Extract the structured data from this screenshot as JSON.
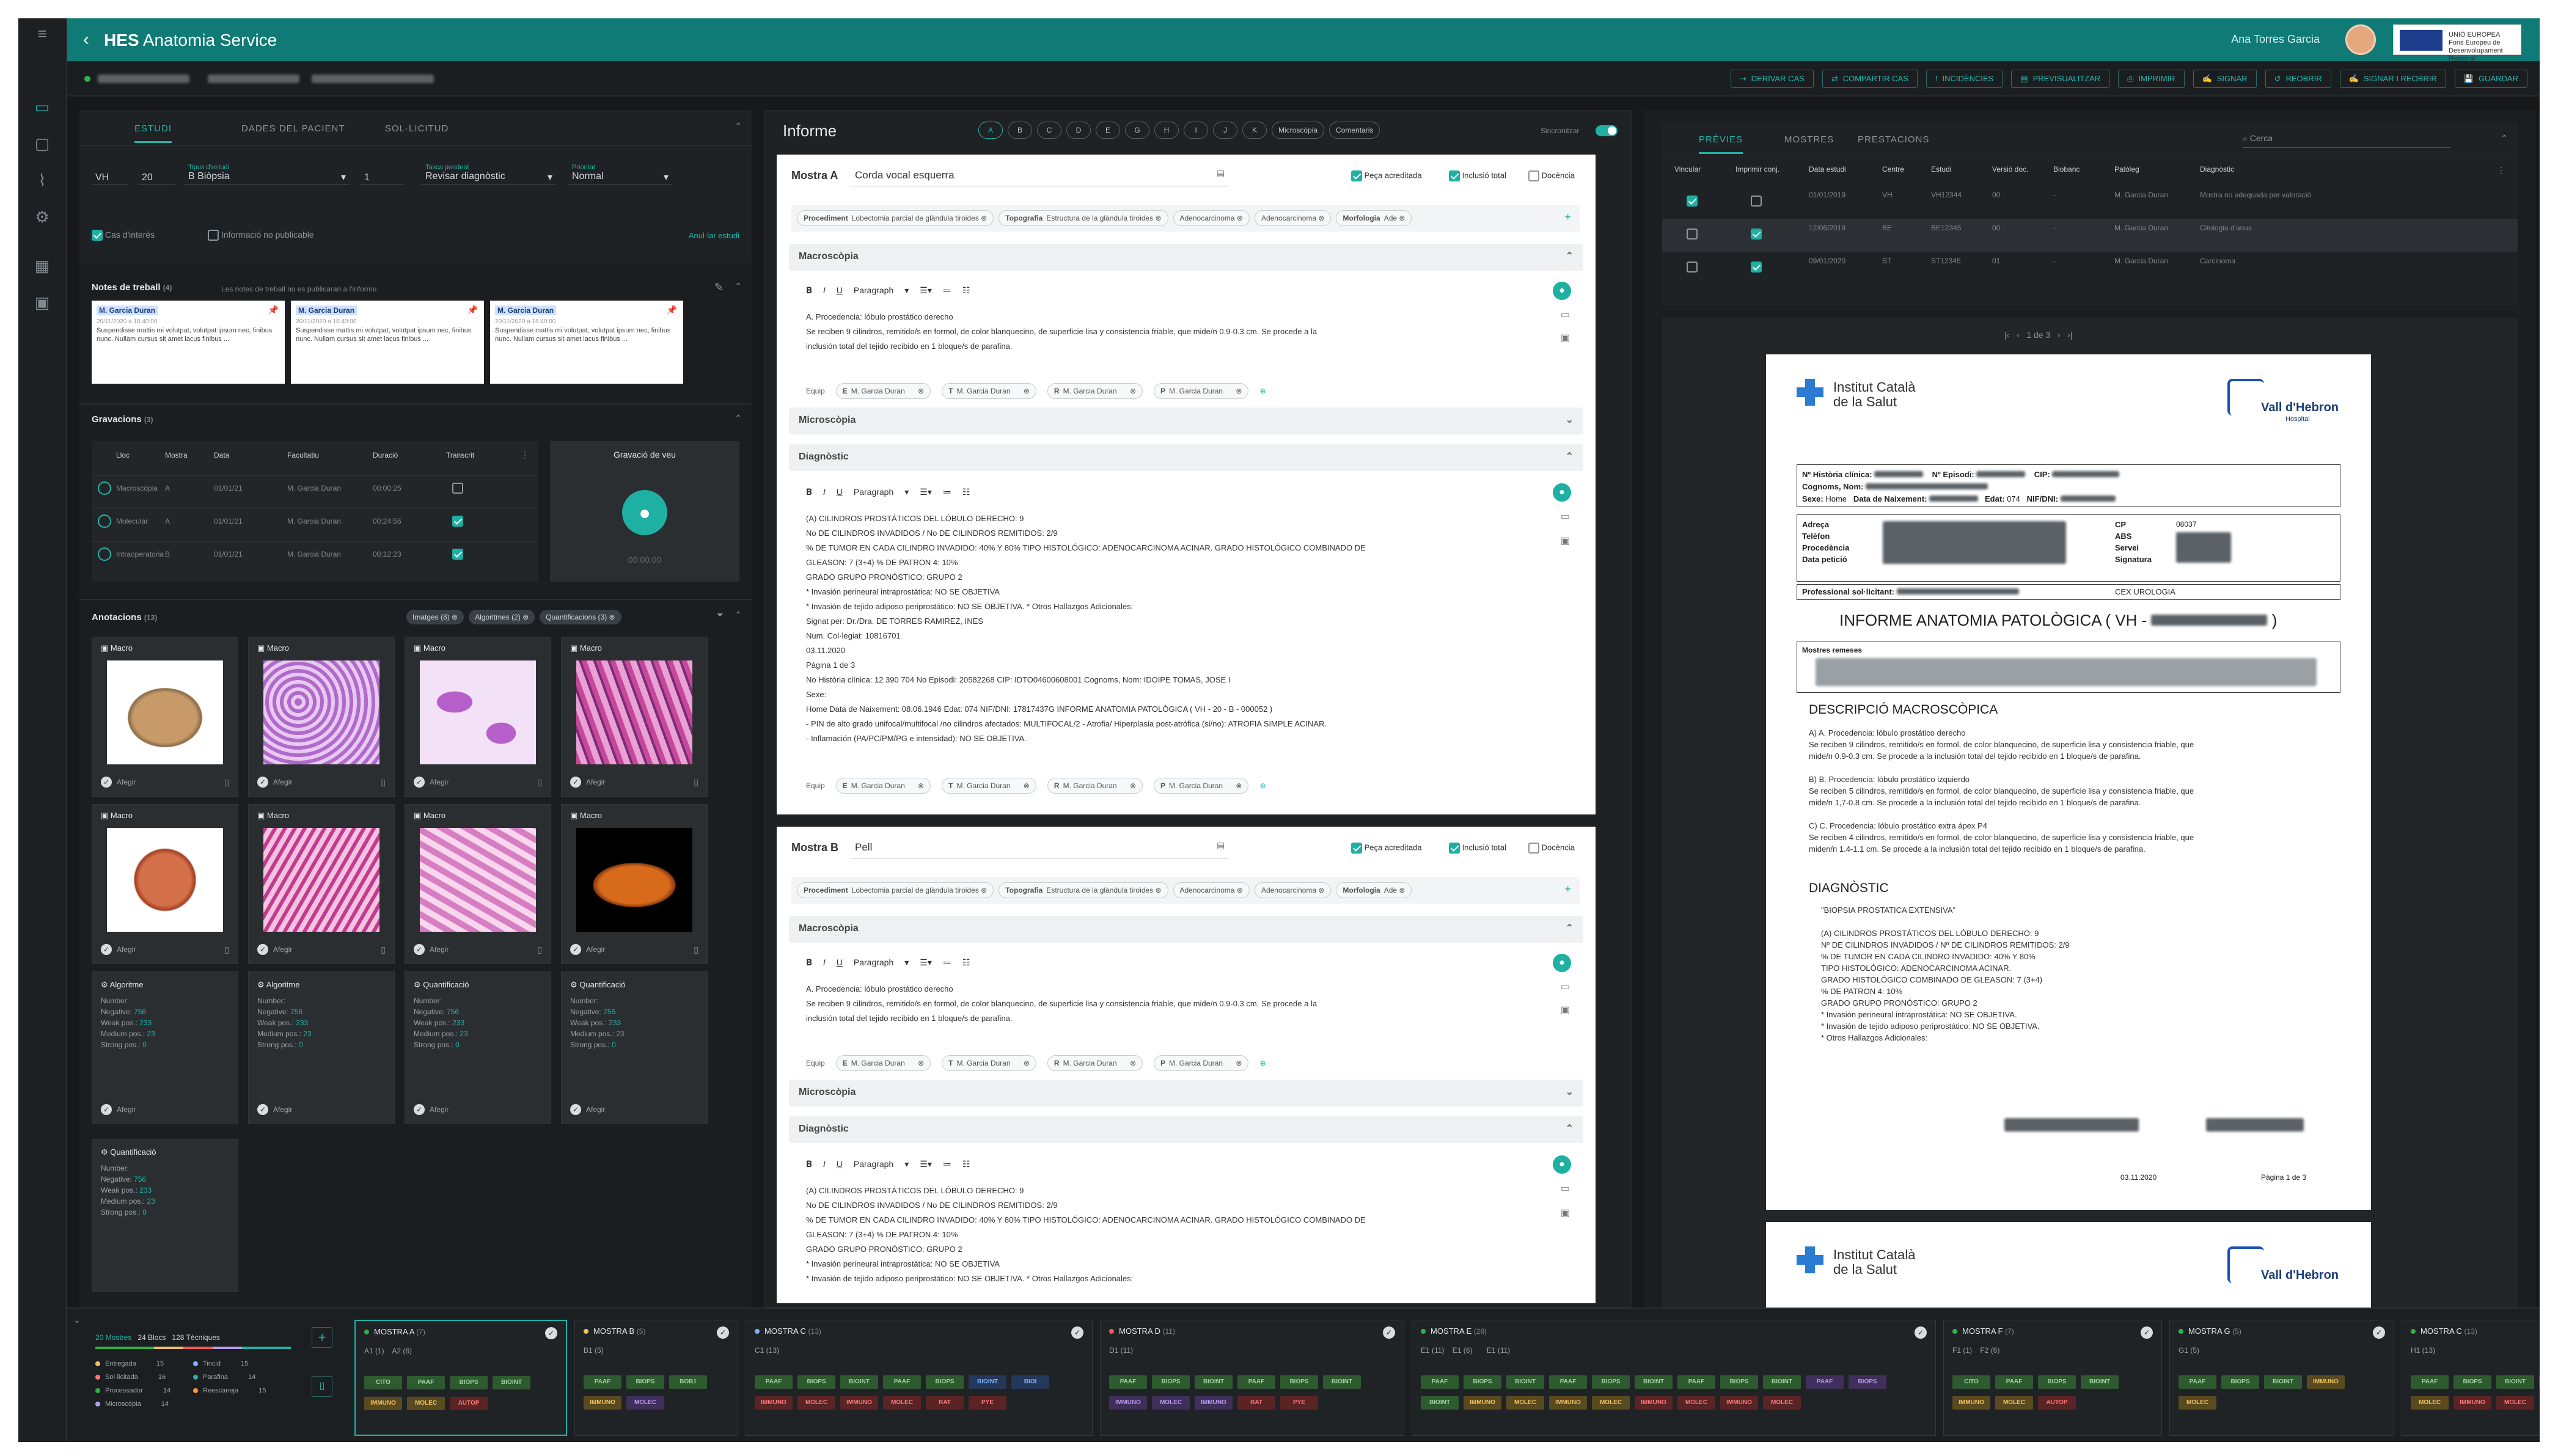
{
  "app": {
    "title_bold": "HES",
    "title_rest": "Anatomia Service",
    "user": "Ana Torres Garcia",
    "eu_text": "UNIÓ EUROPEA\nFons Europeu de\nDesenvolupament Regional"
  },
  "actions": [
    "DERIVAR CAS",
    "COMPARTIR CAS",
    "INCIDÈNCIES",
    "PREVISUALITZAR",
    "IMPRIMIR",
    "SIGNAR",
    "REOBRIR",
    "SIGNAR I REOBRIR",
    "GUARDAR"
  ],
  "left": {
    "tabs": [
      "ESTUDI",
      "DADES DEL PACIENT",
      "SOL·LICITUD"
    ],
    "study": {
      "prefix": "VH",
      "year": "20",
      "type_label": "Tipus d'estudi",
      "type_value": "B Biòpsia",
      "num": "1",
      "task_label": "Tasca pendent",
      "task_value": "Revisar diagnòstic",
      "prio_label": "Prioritat",
      "prio_value": "Normal",
      "interest": "Cas d'interès",
      "nopub": "Informació no publicable",
      "cancel": "Anul·lar estudi"
    },
    "notes": {
      "title": "Notes de treball",
      "count": "(4)",
      "hint": "Les notes de treball no es publicaran a l'informe",
      "items": [
        {
          "author": "M. Garcia Duran",
          "date": "20/11/2020 a 18:40:00",
          "text": "Suspendisse mattis mi volutpat, volutpat ipsum nec, finibus nunc. Nullam cursus sit amet lacus finibus ..."
        },
        {
          "author": "M. Garcia Duran",
          "date": "20/11/2020 a 18:40:00",
          "text": "Suspendisse mattis mi volutpat, volutpat ipsum nec, finibus nunc. Nullam cursus sit amet lacus finibus ..."
        },
        {
          "author": "M. Garcia Duran",
          "date": "20/11/2020 a 18:40:00",
          "text": "Suspendisse mattis mi volutpat, volutpat ipsum nec, finibus nunc. Nullam cursus sit amet lacus finibus ..."
        }
      ]
    },
    "recordings": {
      "title": "Gravacions",
      "count": "(3)",
      "cols": [
        "Lloc",
        "Mostra",
        "Data",
        "Facultatiu",
        "Duració",
        "Transcrit"
      ],
      "rows": [
        {
          "place": "Macroscòpia",
          "sample": "A",
          "date": "01/01/21",
          "doctor": "M. Garcia Duran",
          "dur": "00:00:25",
          "done": false
        },
        {
          "place": "Molecular",
          "sample": "A",
          "date": "01/01/21",
          "doctor": "M. Garcia Duran",
          "dur": "00:24:56",
          "done": true
        },
        {
          "place": "Intraoperatoria",
          "sample": "B",
          "date": "01/01/21",
          "doctor": "M. Garcia Duran",
          "dur": "00:12:23",
          "done": true
        }
      ],
      "voice_title": "Gravació de veu",
      "voice_time": "00:00:00"
    },
    "annotations": {
      "title": "Anotacions",
      "count": "(13)",
      "filters": [
        "Imatges (8)",
        "Algoritmes (2)",
        "Quantificacions (3)"
      ],
      "cards": [
        {
          "t": "Macro",
          "img": "macro1"
        },
        {
          "t": "Macro",
          "img": "he1"
        },
        {
          "t": "Macro",
          "img": "he2"
        },
        {
          "t": "Macro",
          "img": "he3"
        },
        {
          "t": "Macro",
          "img": "macro2"
        },
        {
          "t": "Macro",
          "img": "he4"
        },
        {
          "t": "Macro",
          "img": "he5"
        },
        {
          "t": "Macro",
          "img": "macro3"
        }
      ],
      "choose": "Afegir",
      "quant": [
        {
          "t": "Algoritme"
        },
        {
          "t": "Algoritme"
        },
        {
          "t": "Quantificació"
        },
        {
          "t": "Quantificació"
        },
        {
          "t": "Quantificació"
        }
      ],
      "quant_lines": {
        "number": "Number:",
        "neg": "Negative:",
        "neg_v": "756",
        "weak": "Weak pos.:",
        "weak_v": "233",
        "med": "Medium pos.:",
        "med_v": "23",
        "strong": "Strong pos.:",
        "strong_v": "0"
      }
    }
  },
  "report": {
    "title": "Informe",
    "pills": [
      "A",
      "B",
      "C",
      "D",
      "E",
      "G",
      "H",
      "I",
      "J",
      "K",
      "Microscòpia",
      "Comentaris"
    ],
    "sync": "Sincronitzar",
    "sampleA": {
      "label": "Mostra A",
      "name": "Corda vocal esquerra",
      "acc": "Peça acreditada",
      "incl": "Inclusió total",
      "doc": "Docència",
      "chips": [
        [
          "Procediment",
          "Lobectomia parcial de glàndula tiroides"
        ],
        [
          "Topografia",
          "Estructura de la glàndula tiroides"
        ],
        [
          "",
          "Adenocarcinoma"
        ],
        [
          "",
          "Adenocarcinoma"
        ],
        [
          "Morfologia",
          "Ade"
        ]
      ],
      "macro_title": "Macroscòpia",
      "para": "Paragraph",
      "macro_text": "A. Procedencia: lóbulo prostático derecho\nSe reciben 9 cilindros, remitido/s en formol, de color blanquecino, de superficie lisa y consistencia friable, que mide/n 0.9-0.3 cm. Se procede a la\ninclusión total del tejido recibido en 1 bloque/s de parafina.",
      "equip": "Equip",
      "doctor": "M. Garcia Duran",
      "micro_title": "Microscòpia",
      "diag_title": "Diagnòstic",
      "diag_text": "(A) CILINDROS PROSTÁTICOS DEL LÓBULO DERECHO: 9\nNo DE CILINDROS INVADIDOS / No DE CILINDROS REMITIDOS: 2/9\n% DE TUMOR EN CADA CILINDRO INVADIDO: 40% Y 80% TIPO HISTOLÓGICO: ADENOCARCINOMA ACINAR. GRADO HISTOLÓGICO COMBINADO DE\nGLEASON: 7 (3+4) % DE PATRON 4: 10%\nGRADO GRUPO PRONÓSTICO: GRUPO 2\n* Invasión perineural intraprostática: NO SE OBJETIVA\n* Invasión de tejido adiposo periprostático: NO SE OBJETIVA. * Otros Hallazgos Adicionales:\nSignat per: Dr./Dra. DE TORRES RAMIREZ, INES\nNum. Col·legiat: 10816701\n03.11.2020\nPàgina 1 de 3\n   No Història clínica: 12 390 704 No Episodi: 20582268 CIP: IDTO04600608001 Cognoms, Nom: IDOIPE TOMAS, JOSE I\nSexe:\nHome Data de Naixement: 08.06.1946 Edat: 074 NIF/DNI: 17817437G INFORME ANATOMIA PATOLÒGICA ( VH - 20 - B - 000052 )\n- PIN de alto grado unifocal/multifocal /no cilindros afectados: MULTIFOCAL/2 - Atrofia/ Hiperplasia post-atrófica (si/no): ATROFIA SIMPLE ACINAR.\n- Inflamación (PA/PC/PM/PG e intensidad): NO SE OBJETIVA."
    },
    "sampleB": {
      "label": "Mostra B",
      "name": "Pell",
      "diag_text": "(A) CILINDROS PROSTÁTICOS DEL LÓBULO DERECHO: 9\nNo DE CILINDROS INVADIDOS / No DE CILINDROS REMITIDOS: 2/9\n% DE TUMOR EN CADA CILINDRO INVADIDO: 40% Y 80% TIPO HISTOLÓGICO: ADENOCARCINOMA ACINAR. GRADO HISTOLÓGICO COMBINADO DE\nGLEASON: 7 (3+4) % DE PATRON 4: 10%\nGRADO GRUPO PRONÓSTICO: GRUPO 2\n* Invasión perineural intraprostática: NO SE OBJETIVA\n* Invasión de tejido adiposo periprostático: NO SE OBJETIVA. * Otros Hallazgos Adicionales:"
    }
  },
  "right": {
    "tabs": [
      "PRÈVIES",
      "MOSTRES",
      "PRESTACIONS"
    ],
    "search": "Cerca",
    "cols": [
      "Vincular",
      "Imprimir conj.",
      "Data estudi",
      "Centre",
      "Estudi",
      "Versió doc.",
      "Biobanc",
      "Patòleg",
      "Diagnòstic"
    ],
    "rows": [
      {
        "v": true,
        "p": false,
        "date": "01/01/2019",
        "c": "VH",
        "e": "VH12344",
        "ver": "00",
        "bio": "-",
        "pat": "M. Garcia Duran",
        "diag": "Mostra no adequada per valoració"
      },
      {
        "v": false,
        "p": true,
        "date": "12/06/2019",
        "c": "BE",
        "e": "BE12345",
        "ver": "00",
        "bio": "-",
        "pat": "M. Garcia Duran",
        "diag": "Citologia d'anus"
      },
      {
        "v": false,
        "p": true,
        "date": "09/01/2020",
        "c": "ST",
        "e": "ST12345",
        "ver": "01",
        "bio": "-",
        "pat": "M. Garcia Duran",
        "diag": "Carcinoma"
      }
    ],
    "pager": "1 de 3",
    "pdf": {
      "ics1": "Institut Català",
      "ics2": "de la Salut",
      "vh": "Vall d'Hebron",
      "vh2": "Hospital",
      "l1": "Nº Història clínica:",
      "l2": "Nº Episodi:",
      "l3": "CIP:",
      "l4": "Cognoms, Nom:",
      "l5": "Sexe:",
      "l5v": "Home",
      "l6": "Data de Naixement:",
      "l7": "Edat:",
      "l7v": "074",
      "l8": "NIF/DNI:",
      "a1": "Adreça",
      "a2": "Telèfon",
      "a3": "Procedència",
      "a4": "Data petició",
      "b1": "CP",
      "b2": "ABS",
      "b3": "Servei",
      "b4": "Signatura",
      "b1v": "08037",
      "prof": "Professional sol·licitant:",
      "cex": "CEX UROLOGIA",
      "title": "INFORME ANATOMIA PATOLÒGICA  ( VH -",
      "sent": "Mostres remeses",
      "s1": "DESCRIPCIÓ MACROSCÒPICA",
      "macro": "A)   A. Procedencia:  lóbulo prostático derecho\n       Se reciben 9 cilindros, remitido/s en formol, de color blanquecino, de superficie lisa y consistencia friable, que\n       mide/n 0.9-0.3 cm. Se procede a la inclusión total del tejido recibido en 1 bloque/s de parafina.\n\nB)   B. Procedencia:  lóbulo prostático izquierdo\n       Se reciben 5 cilindros, remitido/s en formol, de color blanquecino, de superficie lisa y consistencia friable, que\n       mide/n 1,7-0.8 cm. Se procede a la inclusión total del tejido recibido en 1 bloque/s de parafina.\n\nC)   C. Procedencia:  lóbulo prostático extra ápex P4\n       Se reciben 4 cilindros, remitido/s en formol, de color blanquecino, de superficie lisa y consistencia friable, que\n       miden/n 1.4-1.1 cm. Se procede a la inclusión total del tejido recibido en 1 bloque/s de parafina.",
      "s2": "DIAGNÒSTIC",
      "diag": "\"BIOPSIA PROSTATICA EXTENSIVA\"\n\n(A) CILINDROS PROSTÁTICOS DEL LÓBULO DERECHO: 9\n     Nº DE CILINDROS INVADIDOS / Nº DE CILINDROS REMITIDOS: 2/9\n     %  DE  TUMOR EN CADA CILINDRO INVADIDO: 40% Y 80%\n     TIPO HISTOLÓGICO: ADENOCARCINOMA ACINAR.\n     GRADO HISTOLÓGICO COMBINADO DE GLEASON: 7 (3+4)\n     % DE PATRON 4: 10%\n     GRADO GRUPO PRONÓSTICO: GRUPO 2\n  * Invasión perineural intraprostática:  NO SE OBJETIVA.\n  * Invasión de tejido adiposo periprostático:  NO SE OBJETIVA.\n  * Otros Hallazgos Adicionales:",
      "date": "03.11.2020",
      "page": "Pàgina 1 de 3"
    }
  },
  "tray": {
    "summary": [
      "20 Mostres",
      "24 Blocs",
      "128 Tècniques"
    ],
    "legend": [
      [
        "Entregada",
        "15",
        "#f0c060"
      ],
      [
        "Sol·licitada",
        "16",
        "#ff7777"
      ],
      [
        "Processador",
        "14",
        "#2fb24a"
      ],
      [
        "Microscòpia",
        "14",
        "#b79cf0"
      ],
      [
        "Tincid",
        "15",
        "#7fb0ff"
      ],
      [
        "Parafina",
        "14",
        "#22b3a8"
      ],
      [
        "Reescaneja",
        "15",
        "#ff9933"
      ]
    ],
    "cols": [
      {
        "t": "MOSTRA A",
        "n": "(7)",
        "c": "#2fb24a",
        "sub": "A1 (1)    A2 (6)"
      },
      {
        "t": "MOSTRA B",
        "n": "(5)",
        "c": "#f0c060",
        "sub": "B1 (5)"
      },
      {
        "t": "MOSTRA C",
        "n": "(13)",
        "c": "#7fb0ff",
        "sub": "C1 (13)"
      },
      {
        "t": "MOSTRA D",
        "n": "(11)",
        "c": "#ff5555",
        "sub": "D1 (11)"
      },
      {
        "t": "MOSTRA E",
        "n": "(28)",
        "c": "#2fb24a",
        "sub": "E1 (11)    E1 (6)       E1 (11)"
      },
      {
        "t": "MOSTRA F",
        "n": "(7)",
        "c": "#2fb24a",
        "sub": "F1 (1)    F2 (6)"
      },
      {
        "t": "MOSTRA G",
        "n": "(5)",
        "c": "#2fb24a",
        "sub": "G1 (5)"
      },
      {
        "t": "MOSTRA C",
        "n": "(13)",
        "c": "#2fb24a",
        "sub": "H1 (13)"
      }
    ]
  }
}
